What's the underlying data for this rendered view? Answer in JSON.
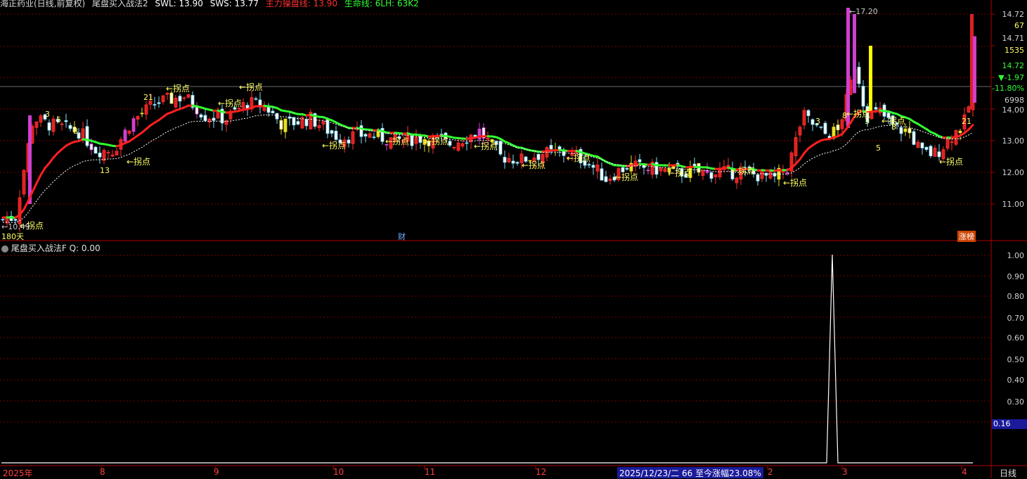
{
  "header": {
    "stock_name": "海正药业(日线,前复权)",
    "indicator": "尾盘买入战法2",
    "swl": "SWL: 13.90",
    "sws": "SWS: 13.77",
    "line_label": "主力操盘线: 13.90",
    "life_label": "生命线: 6LH: 63K2"
  },
  "price_axis": {
    "ticks": [
      "14.72",
      "67",
      "14.71",
      "1535",
      "14.72",
      "▼-1.97",
      "-11.80%",
      "6998",
      "14.00",
      "13.00",
      "12.00",
      "11.00"
    ],
    "high_label": "17.20",
    "low_label": "10.49"
  },
  "annotations": {
    "pivot_label": "←拐点",
    "days_label": "180天",
    "finance_badge": "财",
    "limit_badge": "涨榜",
    "counts": [
      "3",
      "5",
      "8",
      "13",
      "21",
      "3",
      "8",
      "3",
      "5",
      "8",
      "21"
    ]
  },
  "sub_panel": {
    "title": "尾盘买入战法F",
    "q_label": "Q: 0.00",
    "ticks": [
      "1.00",
      "0.90",
      "0.80",
      "0.70",
      "0.60",
      "0.50",
      "0.40",
      "0.30"
    ],
    "current_value": "0.16"
  },
  "x_axis": {
    "labels": [
      "2025年",
      "8",
      "9",
      "10",
      "11",
      "12",
      "2",
      "3",
      "4"
    ],
    "info_bar": "2025/12/23/二 66 至今涨幅23.08%",
    "period": "日线"
  },
  "colors": {
    "up": "#ff3b3b",
    "down": "#54ffff",
    "accent_yellow": "#ffff00",
    "magenta": "#ff40ff",
    "main_line_red": "#ff2020",
    "main_line_green": "#33ff33",
    "grid": "#7a0000"
  }
}
